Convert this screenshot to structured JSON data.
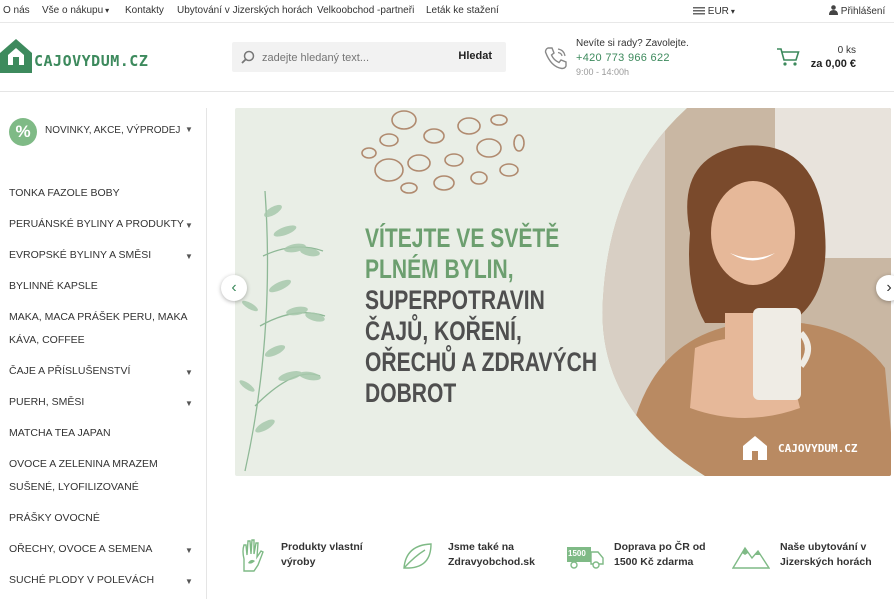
{
  "topbar": {
    "links": [
      "O nás",
      "Vše o nákupu",
      "Kontakty",
      "Ubytování v Jizerských horách",
      "Velkoobchod -partneři",
      "Leták ke stažení"
    ],
    "currency": "EUR",
    "login": "Přihlášení"
  },
  "header": {
    "logo_text": "CAJOVYDUM.CZ",
    "search": {
      "placeholder": "zadejte hledaný text...",
      "button": "Hledat"
    },
    "contact": {
      "question": "Nevíte si rady? Zavolejte.",
      "phone": "+420 773 966 622",
      "hours": "9:00 - 14:00h"
    },
    "cart": {
      "count": "0 ks",
      "total": "za 0,00 €"
    }
  },
  "sidebar": {
    "promo": {
      "icon_text": "%",
      "label": "NOVINKY, AKCE, VÝPRODEJ"
    },
    "items": [
      {
        "label": "TONKA FAZOLE BOBY",
        "has_children": false
      },
      {
        "label": "PERUÁNSKÉ BYLINY A PRODUKTY",
        "has_children": true
      },
      {
        "label": "EVROPSKÉ BYLINY A SMĚSI",
        "has_children": true
      },
      {
        "label": "BYLINNÉ KAPSLE",
        "has_children": false
      },
      {
        "label": "MAKA, MACA PRÁŠEK PERU, MAKA",
        "label2": "KÁVA, COFFEE",
        "has_children": false
      },
      {
        "label": "ČAJE A PŘÍSLUŠENSTVÍ",
        "has_children": true
      },
      {
        "label": "PUERH, SMĚSI",
        "has_children": true
      },
      {
        "label": "MATCHA TEA JAPAN",
        "has_children": false
      },
      {
        "label": "OVOCE A ZELENINA MRAZEM",
        "label2": "SUŠENÉ, LYOFILIZOVANÉ",
        "has_children": false
      },
      {
        "label": "PRÁŠKY OVOCNÉ",
        "has_children": false
      },
      {
        "label": "OŘECHY, OVOCE A SEMENA",
        "has_children": true
      },
      {
        "label": "SUCHÉ PLODY V POLEVÁCH",
        "has_children": true
      }
    ]
  },
  "banner": {
    "headline_green": [
      "VÍTEJTE VE SVĚTĚ",
      "PLNÉM BYLIN,"
    ],
    "headline_gray": [
      "SUPERPOTRAVIN",
      "ČAJŮ, KOŘENÍ,",
      "OŘECHŮ A ZDRAVÝCH",
      "DOBROT"
    ],
    "logo_text": "CAJOVYDUM.CZ"
  },
  "features": [
    {
      "line1": "Produkty vlastní",
      "line2": "výroby",
      "icon": "hand-leaf-icon"
    },
    {
      "line1": "Jsme také na",
      "line2": "Zdravyobchod.sk",
      "icon": "leaf-icon"
    },
    {
      "line1": "Doprava po ČR od",
      "line2": "1500 Kč zdarma",
      "icon": "truck-icon",
      "badge": "1500"
    },
    {
      "line1": "Naše ubytování v",
      "line2": "Jizerských horách",
      "icon": "mountain-icon"
    }
  ],
  "colors": {
    "accent": "#3d8a5d",
    "promo": "#7fba86",
    "banner_bg": "#e9eee6",
    "headline_green": "#6c9f6f",
    "headline_gray": "#4f4f4f"
  }
}
